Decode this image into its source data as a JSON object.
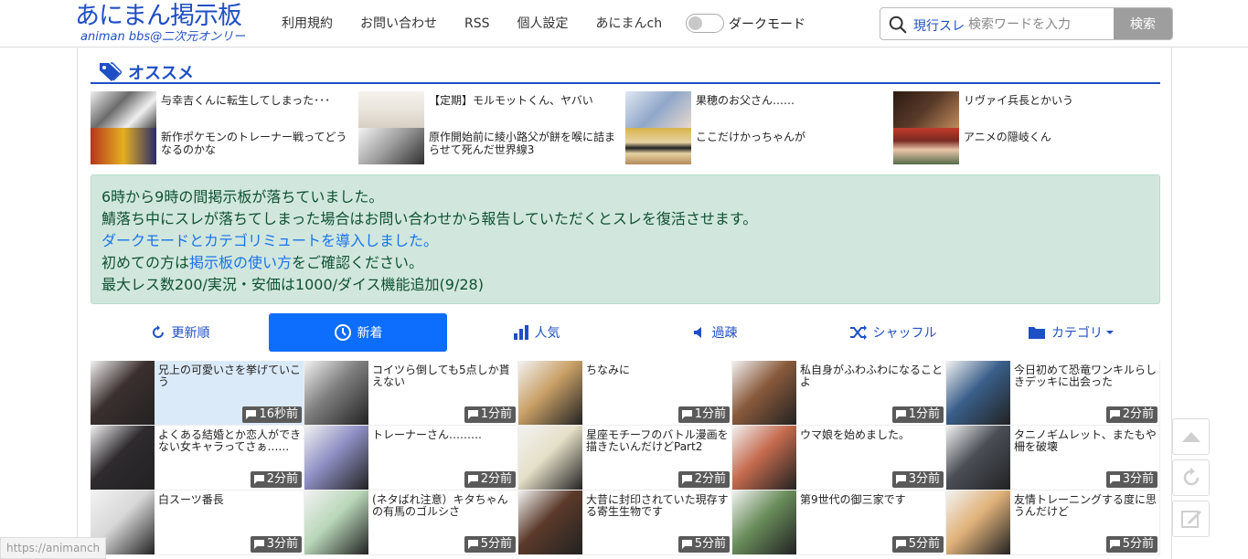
{
  "logo": {
    "main": "あにまん掲示板",
    "sub": "animan bbs@二次元オンリー"
  },
  "nav": [
    "利用規約",
    "お問い合わせ",
    "RSS",
    "個人設定",
    "あにまんch"
  ],
  "dark_mode": {
    "label": "ダークモード",
    "on": false
  },
  "search": {
    "scope": "現行スレ",
    "placeholder": "検索ワードを入力",
    "button": "検索"
  },
  "section_title": "オススメ",
  "recommend": [
    {
      "title": "与幸吉くんに転生してしまった･･･",
      "thumb_color": "#6b6b6b"
    },
    {
      "title": "【定期】モルモットくん、ヤバい",
      "thumb_color": "#e9e4dc"
    },
    {
      "title": "果穂のお父さん……",
      "thumb_color": "#8fa7c9"
    },
    {
      "title": "リヴァイ兵長とかいう",
      "thumb_color": "#5a3b2a"
    },
    {
      "title": "新作ポケモンのトレーナー戦ってどうなるのかな",
      "thumb_color": "#b5361f"
    },
    {
      "title": "原作開始前に綾小路父が餅を喉に詰まらせて死んだ世界線3",
      "thumb_color": "#9a9a9a"
    },
    {
      "title": "ここだけかっちゃんが",
      "thumb_color": "#d8b24a"
    },
    {
      "title": "アニメの隠岐くん",
      "thumb_color": "#7a2a22"
    }
  ],
  "notice": {
    "line1": "6時から9時の間掲示板が落ちていました。",
    "line2": "鯖落ち中にスレが落ちてしまった場合はお問い合わせから報告していただくとスレを復活させます。",
    "line3": "ダークモードとカテゴリミュートを導入しました。",
    "line4_pre": "初めての方は",
    "line4_link": "掲示板の使い方",
    "line4_post": "をご確認ください。",
    "line5": "最大レス数200/実況・安価は1000/ダイス機能追加(9/28)"
  },
  "tabs": [
    {
      "label": "更新順",
      "icon": "refresh-icon",
      "active": false
    },
    {
      "label": "新着",
      "icon": "clock-icon",
      "active": true
    },
    {
      "label": "人気",
      "icon": "bar-chart-icon",
      "active": false
    },
    {
      "label": "過疎",
      "icon": "speaker-icon",
      "active": false
    },
    {
      "label": "シャッフル",
      "icon": "shuffle-icon",
      "active": false
    },
    {
      "label": "カテゴリ",
      "icon": "folder-icon",
      "active": false
    }
  ],
  "threads": [
    {
      "title": "兄上の可愛いさを挙げていこう",
      "time": "16秒前",
      "thumb_color": "#3b2f2f",
      "highlight": true
    },
    {
      "title": "コイツら倒しても5点しか貰えない",
      "time": "1分前",
      "thumb_color": "#7e7e7e",
      "highlight": false
    },
    {
      "title": "ちなみに",
      "time": "1分前",
      "thumb_color": "#c9a067",
      "highlight": false
    },
    {
      "title": "私自身がふわふわになることよ",
      "time": "1分前",
      "thumb_color": "#8a5a3c",
      "highlight": false
    },
    {
      "title": "今日初めて恐竜ワンキルらしきデッキに出会った",
      "time": "2分前",
      "thumb_color": "#3a5f8a",
      "highlight": false
    },
    {
      "title": "よくある結婚とか恋人ができない女キャラってさぁ……",
      "time": "2分前",
      "thumb_color": "#2e2a2e",
      "highlight": false
    },
    {
      "title": "トレーナーさん………",
      "time": "2分前",
      "thumb_color": "#8e8fc4",
      "highlight": false
    },
    {
      "title": "星座モチーフのバトル漫画を描きたいんだけどPart2",
      "time": "2分前",
      "thumb_color": "#e6e0c8",
      "highlight": false
    },
    {
      "title": "ウマ娘を始めました。",
      "time": "3分前",
      "thumb_color": "#c46a4d",
      "highlight": false
    },
    {
      "title": "タニノギムレット、またもや柵を破壊",
      "time": "3分前",
      "thumb_color": "#4a4e56",
      "highlight": false
    },
    {
      "title": "白スーツ番長",
      "time": "3分前",
      "thumb_color": "#d8d8d8",
      "highlight": false
    },
    {
      "title": "(ネタばれ注意）キタちゃんの有馬のゴルシさ",
      "time": "5分前",
      "thumb_color": "#b9d7b9",
      "highlight": false
    },
    {
      "title": "大昔に封印されていた現存する寄生生物です",
      "time": "5分前",
      "thumb_color": "#5b3a2a",
      "highlight": false
    },
    {
      "title": "第9世代の御三家です",
      "time": "5分前",
      "thumb_color": "#6a8e5c",
      "highlight": false
    },
    {
      "title": "友情トレーニングする度に思うんだけど",
      "time": "5分前",
      "thumb_color": "#e0b27a",
      "highlight": false
    }
  ],
  "statusbar": "https://animanch"
}
